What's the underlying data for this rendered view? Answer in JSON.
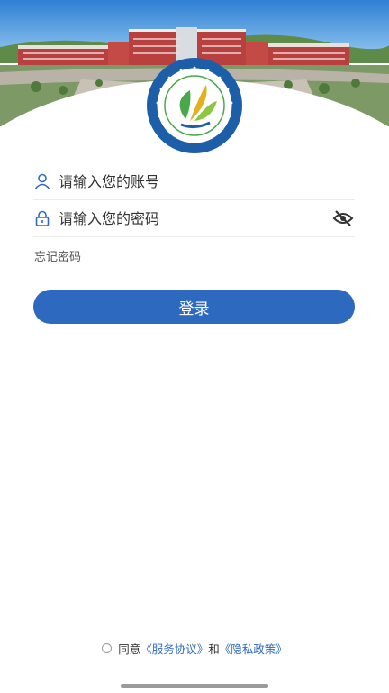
{
  "header": {
    "logo_name": "school-logo"
  },
  "form": {
    "account_placeholder": "请输入您的账号",
    "password_placeholder": "请输入您的密码",
    "forgot_label": "忘记密码",
    "login_label": "登录"
  },
  "agreement": {
    "prefix": "同意",
    "service_link": "《服务协议》",
    "and": "和",
    "privacy_link": "《隐私政策》"
  },
  "colors": {
    "primary": "#2d6abf",
    "icon_blue": "#2d6abf"
  }
}
